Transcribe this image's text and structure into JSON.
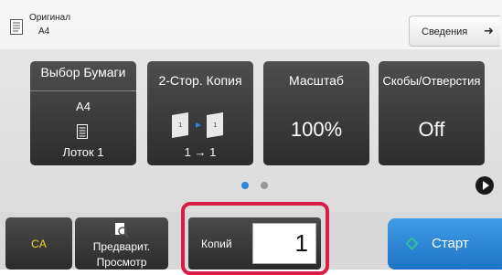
{
  "header": {
    "original_label": "Оригинал",
    "original_size": "A4",
    "info_button_label": "Сведения"
  },
  "tiles": [
    {
      "title": "Выбор Бумаги",
      "value": "A4",
      "icon": "tray-icon",
      "footer": "Лоток 1"
    },
    {
      "title": "2-Стор. Копия",
      "icon": "duplex-icon",
      "footer": "1 → 1"
    },
    {
      "title": "Масштаб",
      "value": "100%"
    },
    {
      "title": "Скобы/Отверстия",
      "value": "Off"
    }
  ],
  "pager": {
    "pages": 2,
    "current": 1
  },
  "bottom": {
    "ca_label": "CA",
    "preview_label_line1": "Предварит.",
    "preview_label_line2": "Просмотр",
    "copies_label": "Копий",
    "copies_value": "1",
    "start_label": "Старт"
  },
  "colors": {
    "accent_blue": "#2a86d8",
    "highlight_red": "#d81e48",
    "ca_text": "#f3d23b",
    "start_green": "#2fc09a"
  }
}
